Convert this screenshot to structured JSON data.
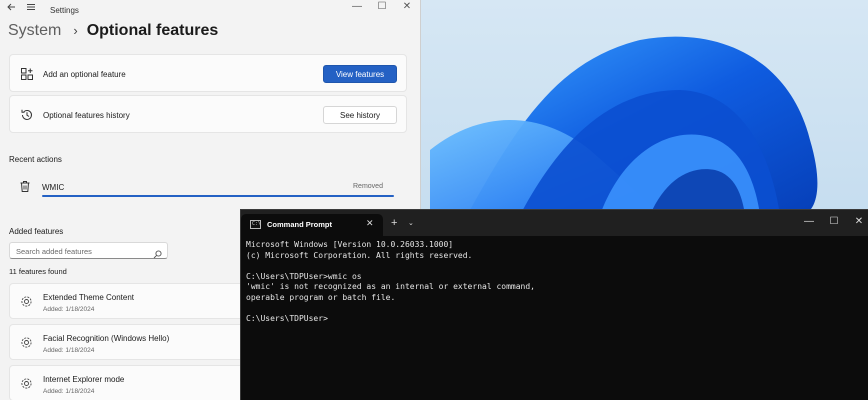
{
  "settings": {
    "window_title": "Settings",
    "back_icon": "back-arrow-icon",
    "menu_icon": "hamburger-menu-icon",
    "breadcrumb": {
      "parent": "System",
      "separator": "›",
      "current": "Optional features"
    },
    "add_feature": {
      "label": "Add an optional feature",
      "button": "View features",
      "icon": "add-feature-icon"
    },
    "history": {
      "label": "Optional features history",
      "button": "See history",
      "icon": "history-icon"
    },
    "recent_actions": {
      "heading": "Recent actions",
      "items": [
        {
          "name": "WMIC",
          "status": "Removed",
          "icon": "trash-icon",
          "progress": 1.0
        }
      ]
    },
    "added_features": {
      "heading": "Added features",
      "search_placeholder": "Search added features",
      "count": "11 features found",
      "items": [
        {
          "name": "Extended Theme Content",
          "date": "Added: 1/18/2024"
        },
        {
          "name": "Facial Recognition (Windows Hello)",
          "date": "Added: 1/18/2024"
        },
        {
          "name": "Internet Explorer mode",
          "date": "Added: 1/18/2024"
        }
      ]
    },
    "controls": {
      "minimize": "—",
      "maximize": "☐",
      "close": "✕"
    }
  },
  "terminal": {
    "tab_title": "Command Prompt",
    "tab_icon_text": "C:\\",
    "tab_close": "✕",
    "new_tab": "+",
    "dropdown": "⌄",
    "controls": {
      "minimize": "—",
      "maximize": "☐",
      "close": "✕"
    },
    "lines": [
      "Microsoft Windows [Version 10.0.26033.1000]",
      "(c) Microsoft Corporation. All rights reserved.",
      "",
      "C:\\Users\\TDPUser>wmic os",
      "'wmic' is not recognized as an internal or external command,",
      "operable program or batch file.",
      "",
      "C:\\Users\\TDPUser>"
    ]
  },
  "colors": {
    "accent": "#2461c4",
    "terminal_bg": "#0c0c0c",
    "wallpaper_bloom": "#1565e8"
  }
}
